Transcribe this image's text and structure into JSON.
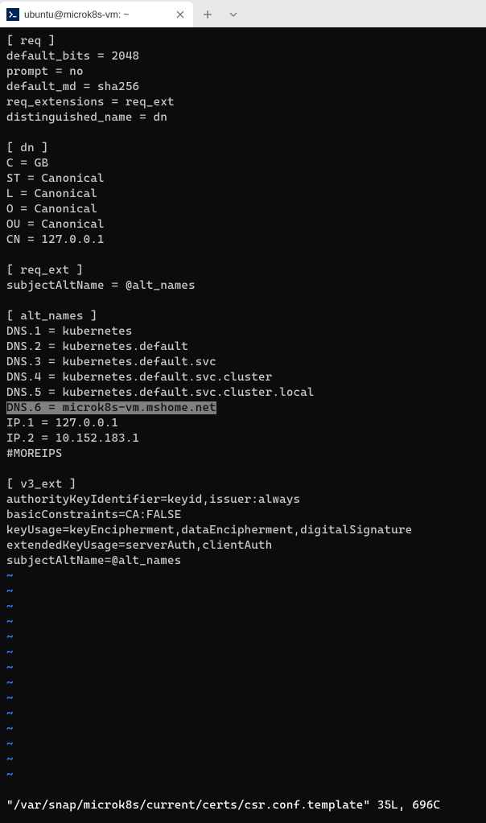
{
  "tab": {
    "title": "ubuntu@microk8s-vm: ~",
    "icon_label": ">_"
  },
  "terminal": {
    "lines": [
      "[ req ]",
      "default_bits = 2048",
      "prompt = no",
      "default_md = sha256",
      "req_extensions = req_ext",
      "distinguished_name = dn",
      "",
      "[ dn ]",
      "C = GB",
      "ST = Canonical",
      "L = Canonical",
      "O = Canonical",
      "OU = Canonical",
      "CN = 127.0.0.1",
      "",
      "[ req_ext ]",
      "subjectAltName = @alt_names",
      "",
      "[ alt_names ]",
      "DNS.1 = kubernetes",
      "DNS.2 = kubernetes.default",
      "DNS.3 = kubernetes.default.svc",
      "DNS.4 = kubernetes.default.svc.cluster",
      "DNS.5 = kubernetes.default.svc.cluster.local"
    ],
    "highlighted_line": "DNS.6 = microk8s-vm.mshome.net",
    "lines_after": [
      "IP.1 = 127.0.0.1",
      "IP.2 = 10.152.183.1",
      "#MOREIPS",
      "",
      "[ v3_ext ]",
      "authorityKeyIdentifier=keyid,issuer:always",
      "basicConstraints=CA:FALSE",
      "keyUsage=keyEncipherment,dataEncipherment,digitalSignature",
      "extendedKeyUsage=serverAuth,clientAuth",
      "subjectAltName=@alt_names"
    ],
    "tilde_count": 14,
    "status_line": "\"/var/snap/microk8s/current/certs/csr.conf.template\" 35L, 696C"
  }
}
